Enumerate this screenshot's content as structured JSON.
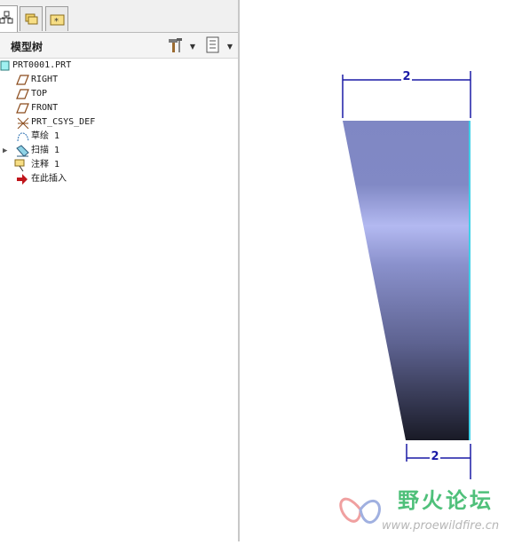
{
  "tabs": [
    {
      "icon": "model-tree-icon"
    },
    {
      "icon": "folder-browser-icon"
    },
    {
      "icon": "favorites-folder-icon"
    }
  ],
  "header": {
    "title": "模型树",
    "settings_icon": "hammer-tools-icon",
    "show_icon": "tree-filter-icon"
  },
  "tree": {
    "root": "PRT0001.PRT",
    "items": [
      {
        "label": "RIGHT",
        "icon": "datum-plane-icon"
      },
      {
        "label": "TOP",
        "icon": "datum-plane-icon"
      },
      {
        "label": "FRONT",
        "icon": "datum-plane-icon"
      },
      {
        "label": "PRT_CSYS_DEF",
        "icon": "coordinate-system-icon"
      },
      {
        "label": "草绘 1",
        "icon": "sketch-icon"
      },
      {
        "label": "扫描 1",
        "icon": "sweep-icon"
      },
      {
        "label": "注释 1",
        "icon": "annotation-icon"
      },
      {
        "label": "在此插入",
        "icon": "insert-here-arrow-icon"
      }
    ]
  },
  "graphics": {
    "dim_top": "2",
    "dim_bottom": "2",
    "accent": "#1a1aa6"
  },
  "watermark": {
    "text": "野火论坛",
    "url": "www.proewildfire.cn"
  }
}
